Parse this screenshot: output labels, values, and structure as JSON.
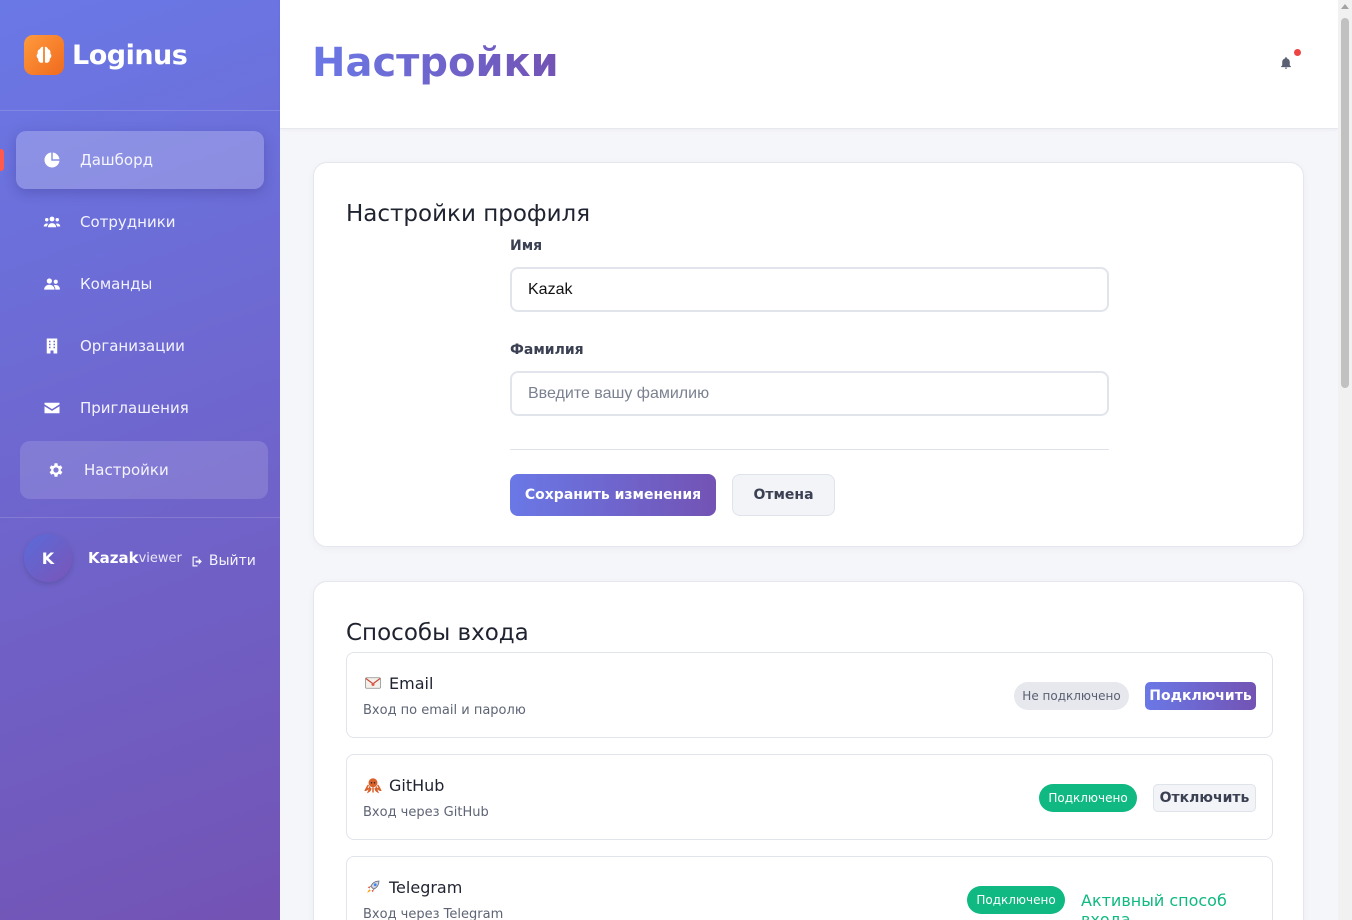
{
  "sidebar": {
    "brand": "Loginus",
    "items": [
      {
        "label": "Дашборд",
        "icon": "pie-chart-icon"
      },
      {
        "label": "Сотрудники",
        "icon": "users-icon"
      },
      {
        "label": "Команды",
        "icon": "team-icon"
      },
      {
        "label": "Организации",
        "icon": "building-icon"
      },
      {
        "label": "Приглашения",
        "icon": "envelope-icon"
      },
      {
        "label": "Настройки",
        "icon": "gear-icon"
      }
    ],
    "user": {
      "initial": "K",
      "name": "Kazak",
      "role": "viewer",
      "logout_label": "Выйти"
    }
  },
  "header": {
    "title": "Настройки",
    "notification_icon": "bell-icon"
  },
  "profile": {
    "title": "Настройки профиля",
    "first_name_label": "Имя",
    "first_name_value": "Kazak",
    "last_name_label": "Фамилия",
    "last_name_placeholder": "Введите вашу фамилию",
    "save_label": "Сохранить изменения",
    "cancel_label": "Отмена"
  },
  "login_methods": {
    "title": "Способы входа",
    "methods": [
      {
        "name": "Email",
        "icon": "envelope-icon",
        "description": "Вход по email и паролю",
        "status": "Не подключено",
        "action": "Подключить"
      },
      {
        "name": "GitHub",
        "icon": "octopus-icon",
        "description": "Вход через GitHub",
        "status": "Подключено",
        "action": "Отключить"
      },
      {
        "name": "Telegram",
        "icon": "rocket-icon",
        "description": "Вход через Telegram",
        "status": "Подключено",
        "action": "Активный способ входа"
      }
    ]
  },
  "colors": {
    "accent": "#6a78e6",
    "accent_end": "#7353b4",
    "success": "#10b981",
    "brand_logo": "#f06a1e"
  }
}
